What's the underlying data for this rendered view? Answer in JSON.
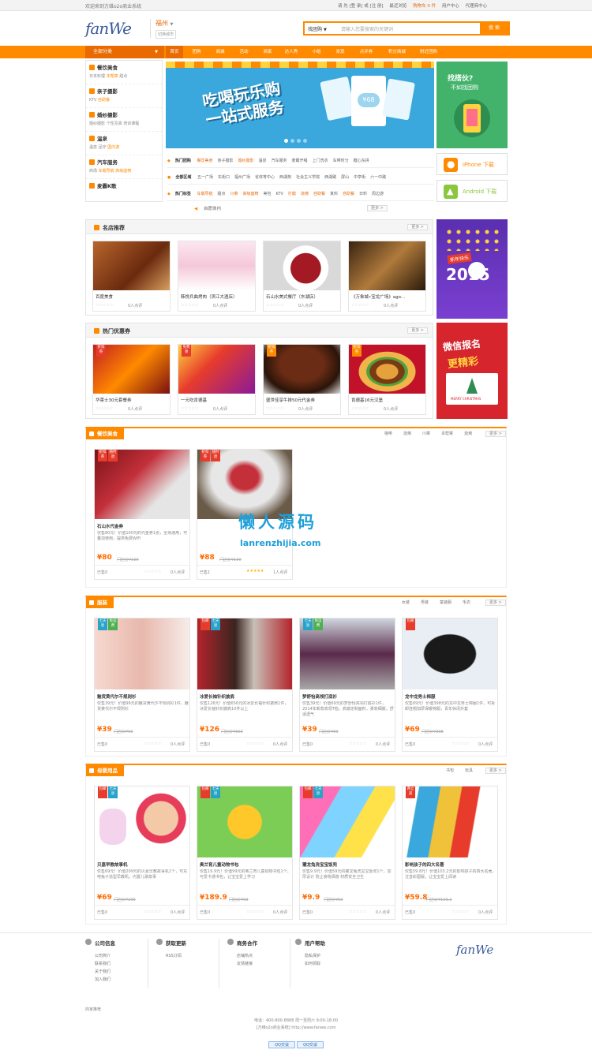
{
  "topbar": {
    "welcome": "欢迎来到方维o2o商业系统",
    "links": [
      "请 先 [登 录] 或 [注 册]",
      "最近浏览",
      "购物车 0 件",
      "用户中心",
      "代理商中心"
    ]
  },
  "header": {
    "logo": "fanWe",
    "city": "福州",
    "city_switch": "切换城市",
    "search_type": "找团购",
    "search_placeholder": "请输入您要搜索的关键词",
    "search_button": "搜 索"
  },
  "nav": {
    "all_categories": "全部分类",
    "items": [
      "首页",
      "团购",
      "商城",
      "活动",
      "商家",
      "达人秀",
      "小组",
      "发现",
      "点评券",
      "积分商城",
      "附近团购"
    ]
  },
  "categories": [
    {
      "title": "餐饮美食",
      "subs": [
        "日本料理",
        "本帮菜",
        "甜点"
      ]
    },
    {
      "title": "亲子摄影",
      "subs": [
        "KTV",
        "自助餐"
      ]
    },
    {
      "title": "婚纱摄影",
      "subs": [
        "婚纱摄影",
        "个性写真",
        "培训课程"
      ]
    },
    {
      "title": "温泉",
      "subs": [
        "温泉",
        "足疗",
        "国内游"
      ]
    },
    {
      "title": "汽车服务",
      "subs": [
        "商场",
        "车载导航",
        "高级座椅"
      ]
    },
    {
      "title": "麦霸K歌",
      "subs": []
    }
  ],
  "banner": {
    "line1": "吃喝玩乐购",
    "line2": "一站式服务",
    "ticket": "¥68"
  },
  "side_ad": {
    "line1": "找搭伙?",
    "line2": "不如找团购"
  },
  "tag_rows": [
    {
      "label": "热门团购",
      "tags": [
        "餐饮美食",
        "亲子摄影",
        "婚纱摄影",
        "温泉",
        "汽车服务",
        "麦霸开唱",
        "上门洗衣",
        "车带时分",
        "糖心东拼"
      ]
    },
    {
      "label": "全部区域",
      "tags": [
        "五一广场",
        "东街口",
        "福州广场",
        "省体育中心",
        "西湖苑",
        "社会主义学院",
        "西湖路",
        "屏山",
        "中亭街",
        "六一中路"
      ]
    },
    {
      "label": "热门标签",
      "tags": [
        "车载导航",
        "甜点",
        "川菜",
        "高级座椅",
        "美包",
        "KTV",
        "打蜡",
        "烧烤",
        "自助餐",
        "真料",
        "自助餐",
        "日料",
        "周边游"
      ]
    }
  ],
  "apps": [
    {
      "label": "iPhone 下载",
      "color": "#ff8a00"
    },
    {
      "label": "Android 下载",
      "color": "#8cc63f"
    }
  ],
  "notice": {
    "text": "自愿体内",
    "more": "更多 >"
  },
  "famous_shops": {
    "title": "名店推荐",
    "more": "更多 >",
    "items": [
      {
        "name": "百度美食",
        "count": "0人点评"
      },
      {
        "name": "韩悦兵曲烤肉（滨江大酒店）",
        "count": "0人点评"
      },
      {
        "name": "石山水美式餐厅（东湖店）",
        "count": "0人点评"
      },
      {
        "name": "《万象城•宝龙广场》ago...",
        "count": "0人点评"
      }
    ]
  },
  "hot_coupons": {
    "title": "热门优惠券",
    "more": "更多 >",
    "items": [
      {
        "name": "华莱士30元套餐券",
        "count": "0人点评",
        "badge": "折扣券"
      },
      {
        "name": "一元吃肯德基",
        "count": "0人点评",
        "badge": "免费领"
      },
      {
        "name": "盛世佳享牛排50元代金券",
        "count": "0人点评",
        "badge": "折扣券"
      },
      {
        "name": "肯德基16元汉堡",
        "count": "0人点评",
        "badge": "折扣券"
      }
    ]
  },
  "right_ads": {
    "ad1_text": "新年快乐",
    "ad1_year": "2015",
    "ad2_line1": "微信报名",
    "ad2_line2": "更精彩",
    "ad2_caption": "MERRY CHRISTMAS"
  },
  "sections": [
    {
      "title": "餐饮美食",
      "tabs": [
        "咖啡",
        "烧烤",
        "川菜",
        "本帮菜",
        "烧烤"
      ],
      "more": "更多 >",
      "items": [
        {
          "name": "石山水代金券",
          "desc": "仅售80元！价值100元的代金券1张，全场通用，可叠加使用，提供免费WiFi",
          "price": "¥80",
          "orig": "门店价¥100",
          "sold": "已售0",
          "count": "0人点评",
          "badges": [
            "折扣券",
            "随时退"
          ]
        },
        {
          "name": "",
          "desc": "",
          "price": "¥88",
          "orig": "门店价¥150",
          "sold": "已售1",
          "count": "1人点评",
          "badges": [
            "折扣券",
            "随时退"
          ]
        }
      ]
    },
    {
      "title": "服装",
      "tabs": [
        "女装",
        "男装",
        "童装服",
        "毛衣"
      ],
      "more": "更多 >",
      "items": [
        {
          "name": "魅货黄代尔不规则衫",
          "desc": "仅售39元！价值99元的魅货黄代尔不规则衫1件，魅货黄代尔不规则衫",
          "price": "¥39",
          "orig": "门店价¥99",
          "sold": "已售0",
          "count": "0人点评",
          "badges": [
            "七天退",
            "免运费"
          ]
        },
        {
          "name": "冰爱长袖针织披肩",
          "desc": "仅售126元！价值656元的冰爱长袖针织披肩1件，冰爱长袖针织披肩10件以上",
          "price": "¥126",
          "orig": "门店价¥656",
          "sold": "已售0",
          "count": "0人点评",
          "badges": [
            "包邮",
            "七天退"
          ]
        },
        {
          "name": "梦舒怡高领打底衫",
          "desc": "仅售39元！价值69元的梦舒怡高领打底衫1件，2014年新款高领T恤，高端定制面料，柔软细腻，舒适透气",
          "price": "¥39",
          "orig": "门店价¥69",
          "sold": "已售0",
          "count": "0人点评",
          "badges": [
            "七天退",
            "免运费"
          ]
        },
        {
          "name": "龙中龙男士棉服",
          "desc": "仅售69元！价值398元的龙中龙男士棉服1件，可拆卸连帽加厚保暖棉服，青年休闲外套",
          "price": "¥69",
          "orig": "门店价¥398",
          "sold": "已售0",
          "count": "0人点评",
          "badges": [
            "包邮"
          ]
        }
      ]
    },
    {
      "title": "母婴用品",
      "tabs": [
        "书包",
        "玩具"
      ],
      "more": "更多 >",
      "items": [
        {
          "name": "贝嘉早教故事机",
          "desc": "仅售69元！价值299元的贝嘉早教故事机1个，可充电兔子造型早教机，内置儿歌故事",
          "price": "¥69",
          "orig": "门店价¥299",
          "sold": "已售0",
          "count": "0人点评",
          "badges": [
            "包邮",
            "七天退"
          ]
        },
        {
          "name": "奥兰育儿童动物书包",
          "desc": "仅售19.9元！价值99元的奥兰育儿童动物书包1个，可爱卡通书包，让宝宝爱上学习",
          "price": "¥189.9",
          "orig": "门店价¥99",
          "sold": "已售0",
          "count": "0人点评",
          "badges": [
            "包邮",
            "七天退"
          ]
        },
        {
          "name": "獾龙兔洗宝宝饭兜",
          "desc": "仅售9.9元！价值59元的獾龙兔洗宝宝饭兜1个，加厚设计 防止食物洒落 材质安全卫生",
          "price": "¥9.9",
          "orig": "门店价¥59",
          "sold": "已售0",
          "count": "0人点评",
          "badges": [
            "包邮",
            "七天退"
          ]
        },
        {
          "name": "影响孩子的四大名著",
          "desc": "仅售59.8元！价值103.2元的影响孩子的四大名著，注音彩图版，让宝宝爱上阅读",
          "price": "¥59.8",
          "orig": "门店价¥103.2",
          "sold": "已售0",
          "count": "0人点评",
          "badges": [
            "两立减"
          ]
        }
      ]
    }
  ],
  "watermark": {
    "cn": "懒人源码",
    "en": "lanrenzhijia.com"
  },
  "footer": {
    "cols": [
      {
        "title": "公司信息",
        "links": [
          "公司简介",
          "联系我们",
          "关于我们",
          "加入我们"
        ]
      },
      {
        "title": "获取更新",
        "links": [
          "RSS订阅"
        ]
      },
      {
        "title": "商务合作",
        "links": [
          "店铺热点",
          "友情链接"
        ]
      },
      {
        "title": "用户帮助",
        "links": [
          "隐私保护",
          "如何领取"
        ]
      }
    ],
    "logo": "fanWe",
    "friend_link": "商家推荐",
    "phone": "电话：400-800-8888 周一至周六 9:00-18:00",
    "copyright": "[方维o2o商业系统] http://www.fanwe.com",
    "qq": [
      "QQ交谈",
      "QQ交谈"
    ]
  }
}
